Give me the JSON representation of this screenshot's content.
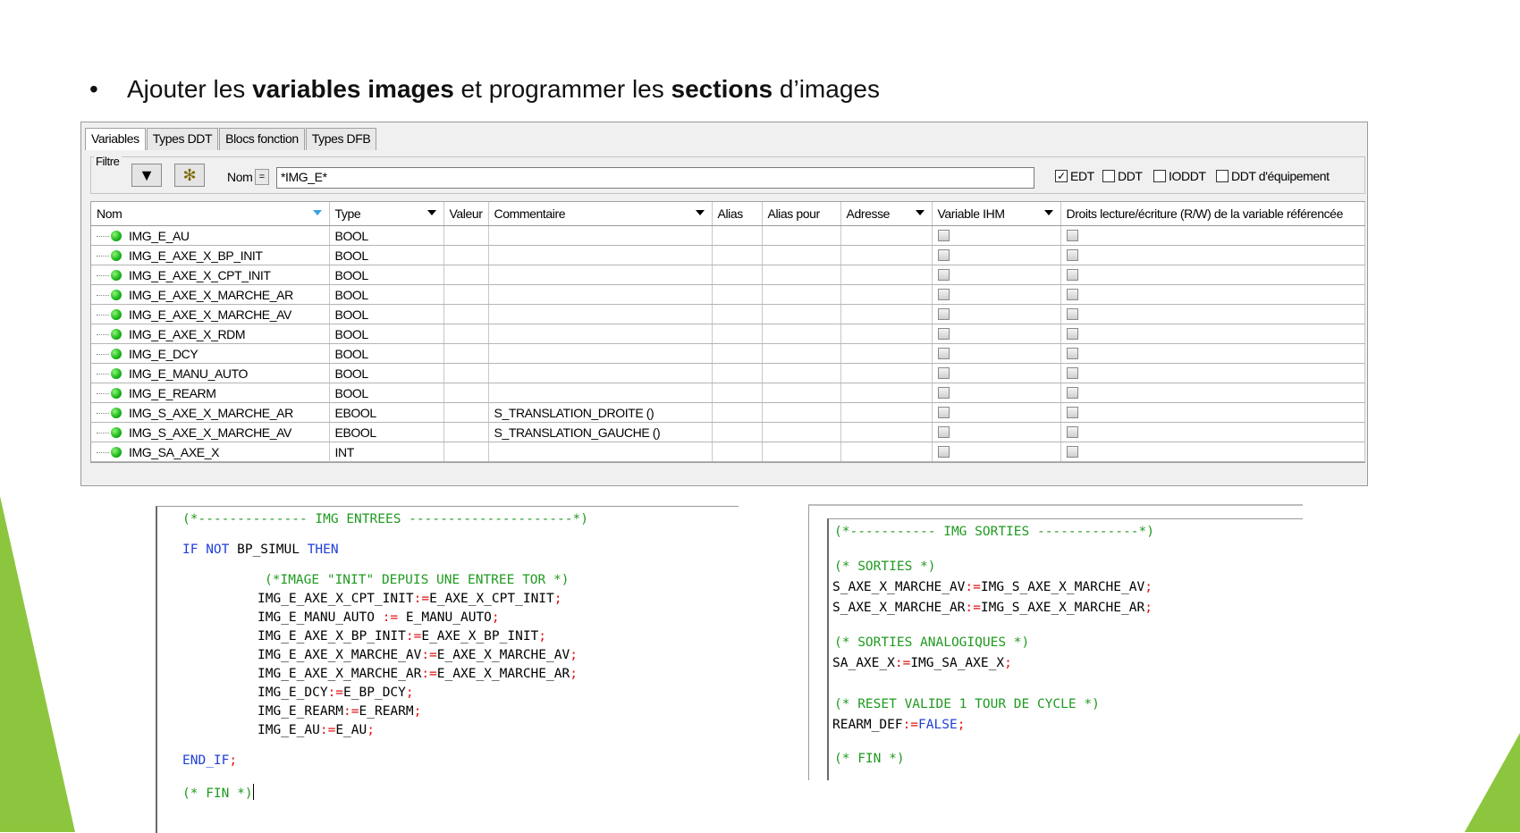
{
  "slide": {
    "bullet_pre": "Ajouter les ",
    "bullet_b1": "variables images",
    "bullet_mid": " et programmer les ",
    "bullet_b2": "sections",
    "bullet_post": " d’images",
    "accent_color": "#8cc63f"
  },
  "editor": {
    "tabs": [
      "Variables",
      "Types DDT",
      "Blocs fonction",
      "Types DFB"
    ],
    "filter_label": "Filtre",
    "nom_label": "Nom",
    "eq": "=",
    "nom_value": "*IMG_E*",
    "checkboxes": [
      {
        "label": "EDT",
        "checked": true
      },
      {
        "label": "DDT",
        "checked": false
      },
      {
        "label": "IODDT",
        "checked": false
      },
      {
        "label": "DDT d'équipement",
        "checked": false
      }
    ],
    "columns": [
      "Nom",
      "Type",
      "Valeur",
      "Commentaire",
      "Alias",
      "Alias pour",
      "Adresse",
      "Variable IHM",
      "Droits lecture/écriture (R/W) de la variable référencée"
    ],
    "rows": [
      {
        "name": "IMG_E_AU",
        "type": "BOOL",
        "comment": ""
      },
      {
        "name": "IMG_E_AXE_X_BP_INIT",
        "type": "BOOL",
        "comment": ""
      },
      {
        "name": "IMG_E_AXE_X_CPT_INIT",
        "type": "BOOL",
        "comment": ""
      },
      {
        "name": "IMG_E_AXE_X_MARCHE_AR",
        "type": "BOOL",
        "comment": ""
      },
      {
        "name": "IMG_E_AXE_X_MARCHE_AV",
        "type": "BOOL",
        "comment": ""
      },
      {
        "name": "IMG_E_AXE_X_RDM",
        "type": "BOOL",
        "comment": ""
      },
      {
        "name": "IMG_E_DCY",
        "type": "BOOL",
        "comment": ""
      },
      {
        "name": "IMG_E_MANU_AUTO",
        "type": "BOOL",
        "comment": ""
      },
      {
        "name": "IMG_E_REARM",
        "type": "BOOL",
        "comment": ""
      },
      {
        "name": "IMG_S_AXE_X_MARCHE_AR",
        "type": "EBOOL",
        "comment": "S_TRANSLATION_DROITE ()"
      },
      {
        "name": "IMG_S_AXE_X_MARCHE_AV",
        "type": "EBOOL",
        "comment": "S_TRANSLATION_GAUCHE ()"
      },
      {
        "name": "IMG_SA_AXE_X",
        "type": "INT",
        "comment": ""
      }
    ]
  },
  "code_left": {
    "l1": "(*-------------- IMG ENTREES ---------------------*)",
    "l2_kw1": "IF NOT",
    "l2_mid": " BP_SIMUL ",
    "l2_kw2": "THEN",
    "l3": "(*IMAGE \"INIT\" DEPUIS UNE ENTREE TOR *)",
    "assigns": [
      {
        "lhs": "IMG_E_AXE_X_CPT_INIT",
        "op": ":=",
        "rhs": "E_AXE_X_CPT_INIT"
      },
      {
        "lhs": "IMG_E_MANU_AUTO ",
        "op": ":=",
        "rhs": " E_MANU_AUTO"
      },
      {
        "lhs": "IMG_E_AXE_X_BP_INIT",
        "op": ":=",
        "rhs": "E_AXE_X_BP_INIT"
      },
      {
        "lhs": "IMG_E_AXE_X_MARCHE_AV",
        "op": ":=",
        "rhs": "E_AXE_X_MARCHE_AV"
      },
      {
        "lhs": "IMG_E_AXE_X_MARCHE_AR",
        "op": ":=",
        "rhs": "E_AXE_X_MARCHE_AR"
      },
      {
        "lhs": "IMG_E_DCY",
        "op": ":=",
        "rhs": "E_BP_DCY"
      },
      {
        "lhs": "IMG_E_REARM",
        "op": ":=",
        "rhs": "E_REARM"
      },
      {
        "lhs": "IMG_E_AU",
        "op": ":=",
        "rhs": "E_AU"
      }
    ],
    "semi": ";",
    "end_if": "END_IF",
    "fin": "(* FIN *)"
  },
  "code_right": {
    "l1": "(*----------- IMG SORTIES -------------*)",
    "c1": "(* SORTIES *)",
    "a1_lhs": "S_AXE_X_MARCHE_AV",
    "a1_rhs": "IMG_S_AXE_X_MARCHE_AV",
    "a2_lhs": "S_AXE_X_MARCHE_AR",
    "a2_rhs": "IMG_S_AXE_X_MARCHE_AR",
    "c2": "(* SORTIES ANALOGIQUES *)",
    "a3_lhs": "SA_AXE_X",
    "a3_rhs": "IMG_SA_AXE_X",
    "c3": "(* RESET VALIDE 1 TOUR DE CYCLE *)",
    "a4_lhs": "REARM_DEF",
    "a4_rhs": "FALSE",
    "fin": "(* FIN *)",
    "op": ":=",
    "semi": ";"
  }
}
